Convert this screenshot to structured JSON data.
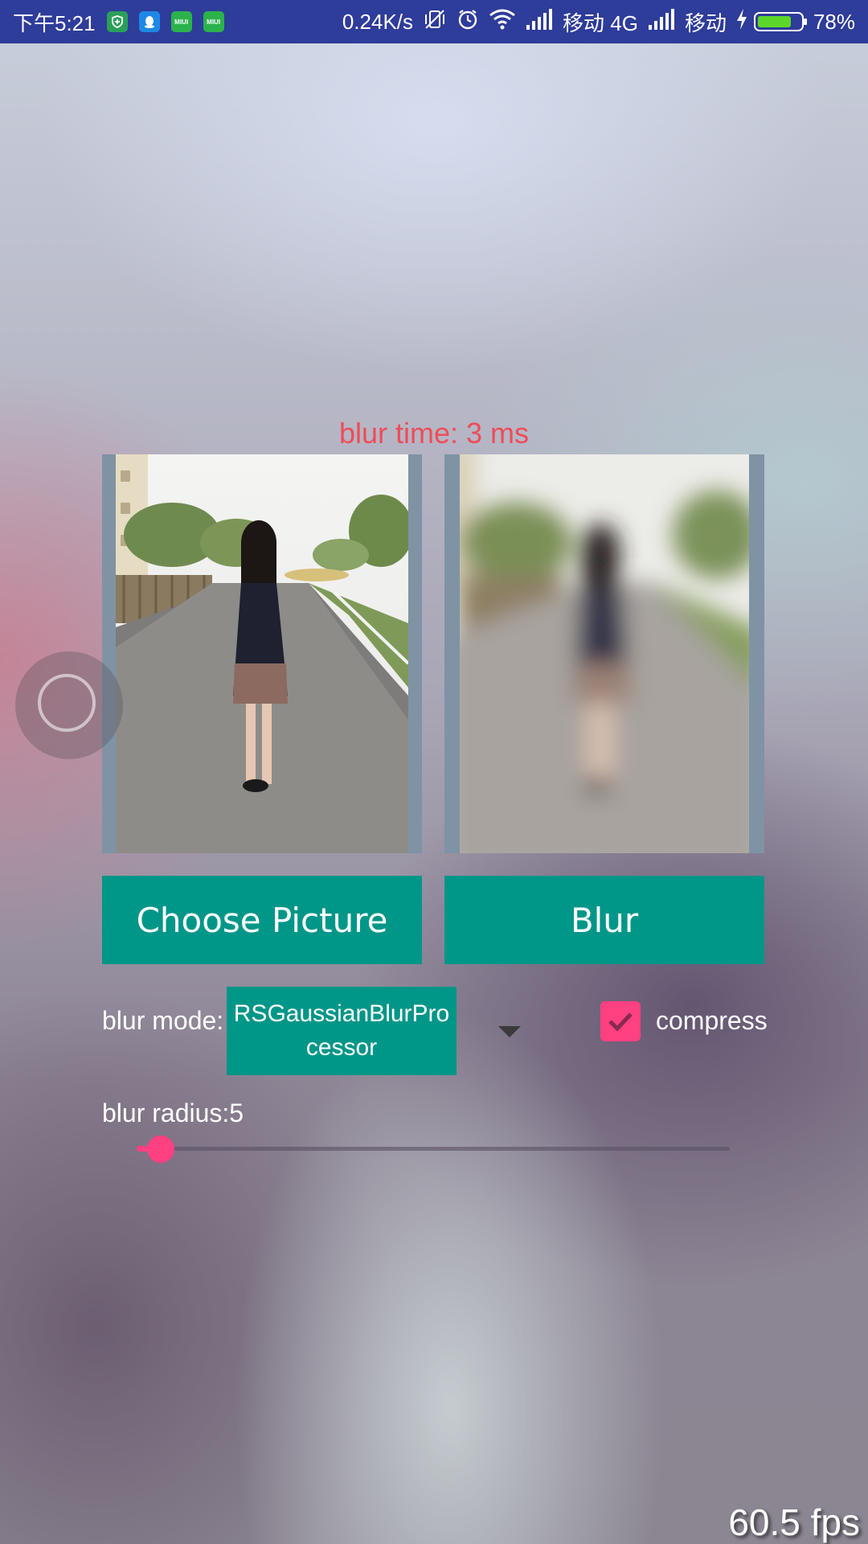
{
  "status_bar": {
    "time": "下午5:21",
    "net_speed": "0.24K/s",
    "carrier1": "移动 4G",
    "carrier2": "移动",
    "battery_text": "78%",
    "battery_level": 0.78,
    "notification_icons": [
      "shield-icon",
      "qq-icon",
      "miui-icon",
      "miui-icon"
    ],
    "miui_label": "MIUI"
  },
  "main": {
    "blur_time_text": "blur time: 3 ms",
    "choose_button_label": "Choose Picture",
    "blur_button_label": "Blur",
    "blur_mode_label": "blur mode:",
    "blur_mode_value": "RSGaussianBlurProcessor",
    "compress_label": "compress",
    "compress_checked": true,
    "blur_radius_label": "blur radius:5",
    "blur_radius_fraction": 0.04
  },
  "overlay": {
    "fps_text": "60.5 fps"
  },
  "colors": {
    "accent": "#009688",
    "pink": "#ff4081",
    "status_bar": "#2e3c9a",
    "blur_time": "#ef4c58"
  }
}
